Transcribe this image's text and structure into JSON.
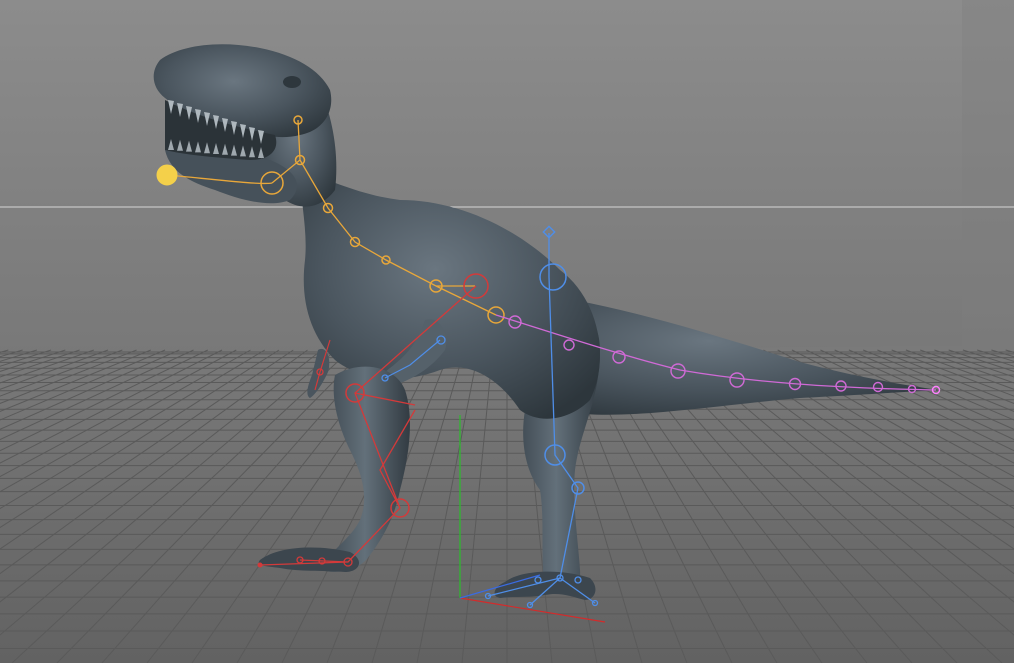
{
  "viewport": {
    "label": "",
    "colors": {
      "background_top": "#8a8a8a",
      "background_bottom": "#5f5f5f",
      "floor": "#707070",
      "grid": "#5a5a5a",
      "horizon": "#d7d7d7",
      "mesh": "#4f5a63",
      "mesh_dark": "#2f383f",
      "spine": "#e8a73a",
      "tail": "#d06ad6",
      "front_leg": "#4f8ee8",
      "back_leg": "#d33a3a",
      "axis_x": "#d32b2b",
      "axis_y": "#2bbd2b",
      "axis_z": "#3a6be3",
      "head_handle": "#f4d04a"
    }
  },
  "rig": {
    "spine_joint_count": 8,
    "tail_joint_count": 10
  }
}
